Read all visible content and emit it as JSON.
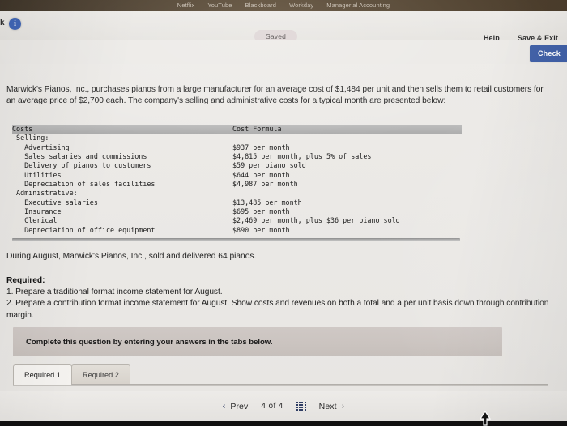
{
  "browser": {
    "bookmarks": [
      {
        "label": "Netflix"
      },
      {
        "label": "YouTube"
      },
      {
        "label": "Blackboard"
      },
      {
        "label": "Workday"
      },
      {
        "label": "Managerial Accounting"
      }
    ]
  },
  "toolbar": {
    "assignment_title": "k",
    "info_icon": "info-icon",
    "saved_badge": "Saved",
    "help_label": "Help",
    "save_exit_label": "Save & Exit",
    "check_label": "Check",
    "accent_color": "#4161a8"
  },
  "question": {
    "intro": "Marwick's Pianos, Inc., purchases pianos from a large manufacturer for an average cost of $1,484 per unit and then sells them to retail customers for an average price of $2,700 each. The company's selling and administrative costs for a typical month are presented below:",
    "table": {
      "headers": [
        "Costs",
        "Cost Formula"
      ],
      "rows": [
        {
          "name": " Selling:",
          "formula": "",
          "indent": 0
        },
        {
          "name": "   Advertising",
          "formula": "$937 per month"
        },
        {
          "name": "   Sales salaries and commissions",
          "formula": "$4,815 per month, plus 5% of sales"
        },
        {
          "name": "   Delivery of pianos to customers",
          "formula": "$59 per piano sold"
        },
        {
          "name": "   Utilities",
          "formula": "$644 per month"
        },
        {
          "name": "   Depreciation of sales facilities",
          "formula": "$4,987 per month"
        },
        {
          "name": " Administrative:",
          "formula": ""
        },
        {
          "name": "   Executive salaries",
          "formula": "$13,485 per month"
        },
        {
          "name": "   Insurance",
          "formula": "$695 per month"
        },
        {
          "name": "   Clerical",
          "formula": "$2,469 per month, plus $36 per piano sold"
        },
        {
          "name": "   Depreciation of office equipment",
          "formula": "$890 per month"
        }
      ]
    },
    "during_line": "During August, Marwick's Pianos, Inc., sold and delivered 64 pianos.",
    "required_label": "Required:",
    "required_items": "1. Prepare a traditional format income statement for August.\n2. Prepare a contribution format income statement for August. Show costs and revenues on both a total and a per unit basis down through contribution margin."
  },
  "answer_area": {
    "instruction": "Complete this question by entering your answers in the tabs below.",
    "tabs": [
      {
        "label": "Required 1",
        "active": true
      },
      {
        "label": "Required 2",
        "active": false
      }
    ]
  },
  "pager": {
    "prev_label": "Prev",
    "prev_icon": "chevron-left-icon",
    "count_label": "4  of  4",
    "grid_icon": "grid-menu-icon",
    "next_label": "Next",
    "next_icon": "chevron-right-icon"
  }
}
